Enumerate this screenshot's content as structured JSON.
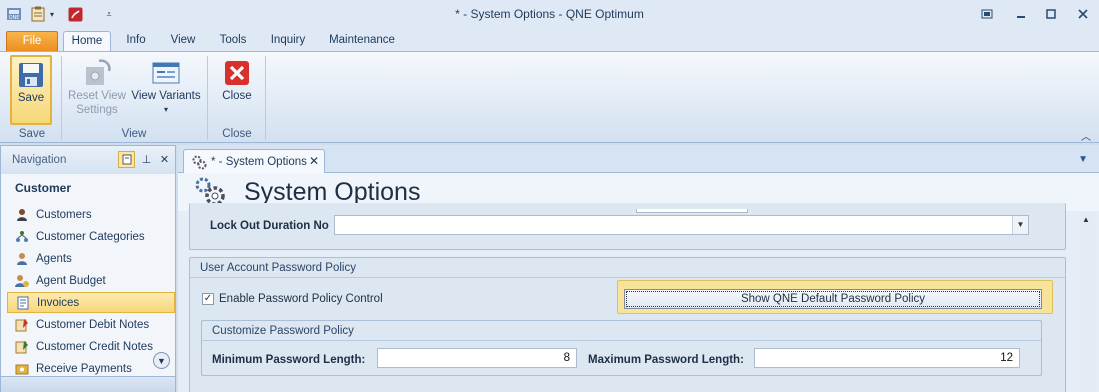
{
  "titlebar": {
    "title": "*  - System Options - QNE Optimum",
    "qat": [
      {
        "icon": "app-logo-icon",
        "label": "QNE"
      },
      {
        "icon": "clipboard-icon"
      },
      {
        "icon": "dropdown-arrow-icon"
      },
      {
        "icon": "pdf-icon"
      },
      {
        "icon": "customize-qat-icon"
      }
    ],
    "window_buttons": [
      "restore-layout-icon",
      "minimize-icon",
      "maximize-icon",
      "close-icon"
    ]
  },
  "ribbon_tabs": [
    {
      "label": "File"
    },
    {
      "label": "Home"
    },
    {
      "label": "Info"
    },
    {
      "label": "View"
    },
    {
      "label": "Tools"
    },
    {
      "label": "Inquiry"
    },
    {
      "label": "Maintenance"
    }
  ],
  "ribbon": {
    "save": {
      "label": "Save",
      "group": "Save"
    },
    "reset_view": {
      "line1": "Reset View",
      "line2": "Settings"
    },
    "view_variants": {
      "label": "View Variants"
    },
    "view_group": "View",
    "close": {
      "label": "Close",
      "group": "Close"
    }
  },
  "navigation": {
    "title": "Navigation",
    "section": "Customer",
    "items": [
      {
        "label": "Customers",
        "icon": "customer-icon"
      },
      {
        "label": "Customer Categories",
        "icon": "categories-icon"
      },
      {
        "label": "Agents",
        "icon": "agent-icon"
      },
      {
        "label": "Agent Budget",
        "icon": "budget-icon"
      },
      {
        "label": "Invoices",
        "icon": "invoice-icon",
        "active": true
      },
      {
        "label": "Customer Debit Notes",
        "icon": "debit-note-icon"
      },
      {
        "label": "Customer Credit Notes",
        "icon": "credit-note-icon"
      },
      {
        "label": "Receive Payments",
        "icon": "payment-icon"
      }
    ]
  },
  "document": {
    "tab_label": "*  - System Options",
    "form_title": "System Options",
    "lockout": {
      "label": "Lock Out Duration No",
      "value": ""
    },
    "password_policy": {
      "title": "User Account Password Policy",
      "enable_label": "Enable Password Policy Control",
      "enable_checked": true,
      "default_button": "Show QNE Default Password Policy",
      "customize": {
        "title": "Customize Password Policy",
        "min_label": "Minimum Password Length:",
        "min_value": "8",
        "max_label": "Maximum Password Length:",
        "max_value": "12"
      }
    }
  }
}
